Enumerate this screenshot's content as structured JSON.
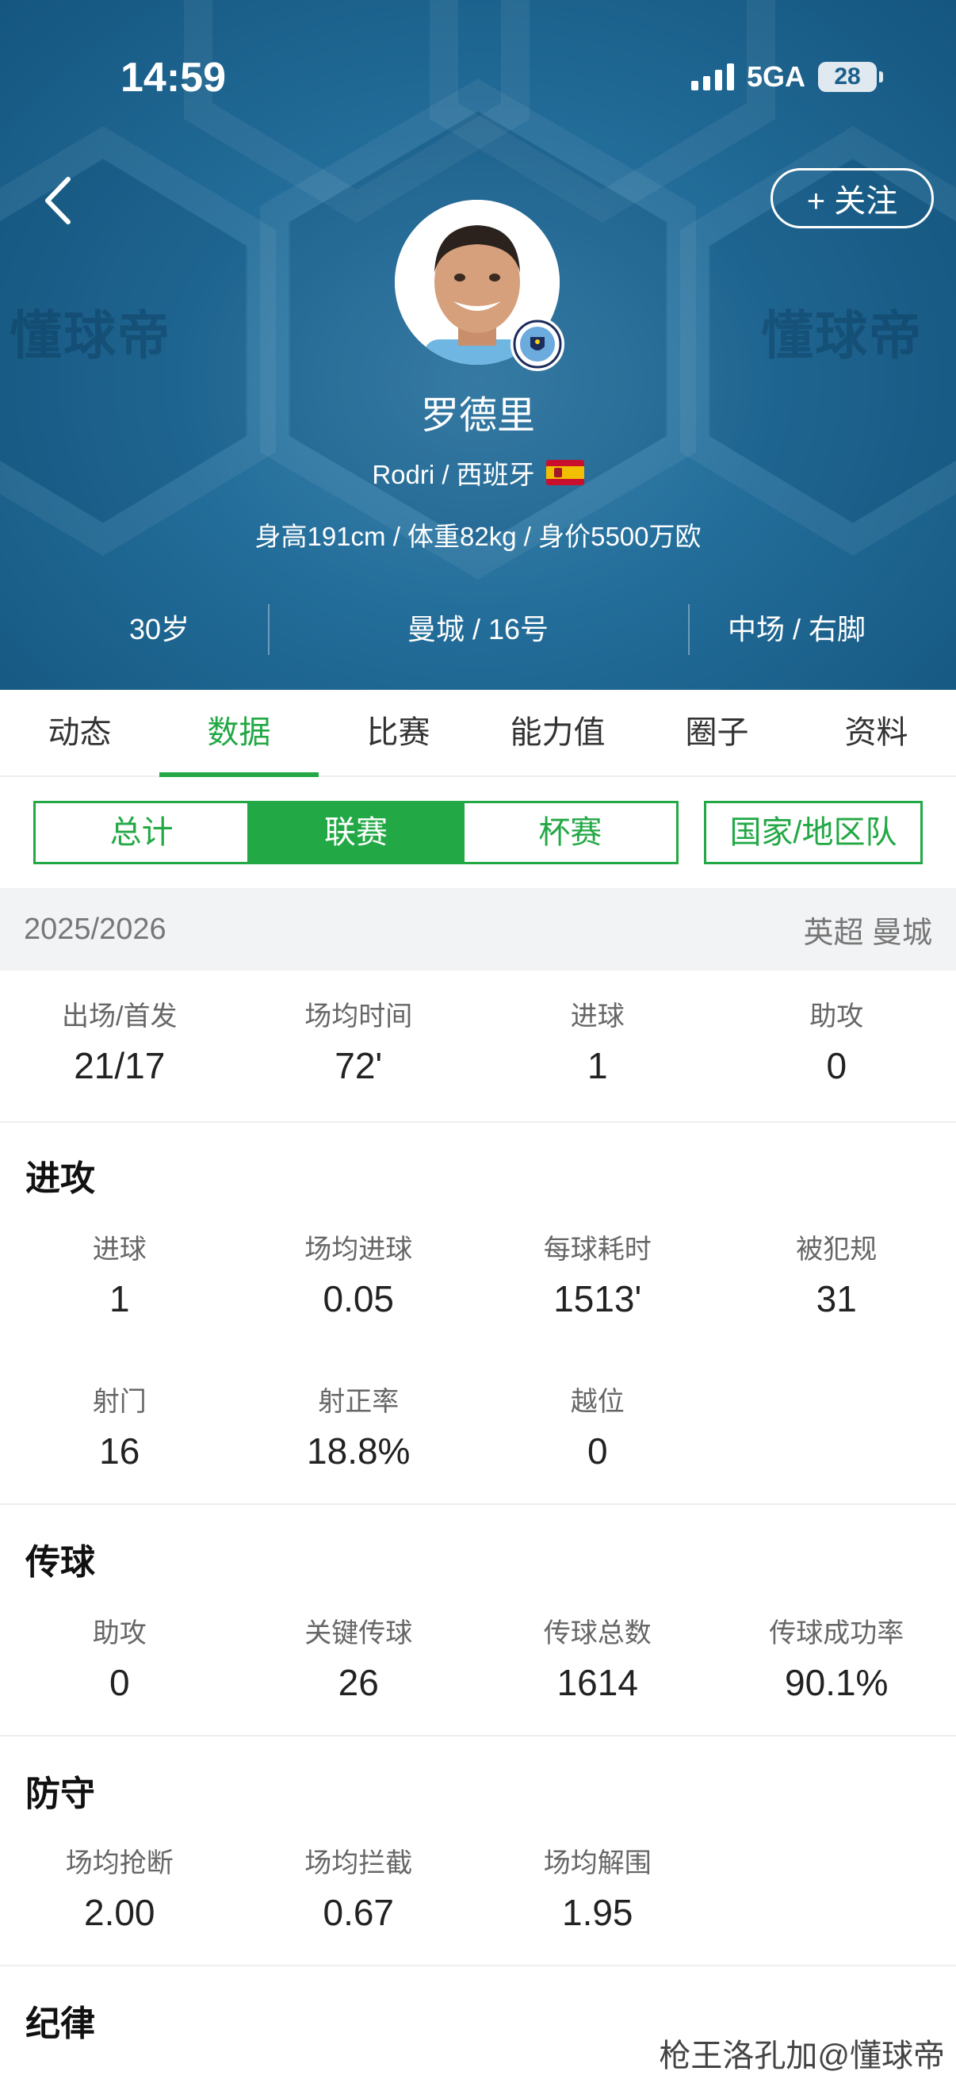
{
  "status_bar": {
    "time": "14:59",
    "network": "5GA",
    "battery": "28"
  },
  "header": {
    "watermark": "懂球帝",
    "follow_label": "+ 关注",
    "player_name": "罗德里",
    "subtitle": "Rodri / 西班牙",
    "body_info": "身高191cm / 体重82kg / 身价5500万欧",
    "info_cells": [
      "30岁",
      "曼城 / 16号",
      "中场 / 右脚"
    ]
  },
  "tabs": [
    "动态",
    "数据",
    "比赛",
    "能力值",
    "圈子",
    "资料"
  ],
  "active_tab": 1,
  "segment": {
    "options": [
      "总计",
      "联赛",
      "杯赛"
    ],
    "active": 1,
    "national_label": "国家/地区队"
  },
  "season": {
    "year": "2025/2026",
    "competition": "英超 曼城"
  },
  "summary": [
    {
      "label": "出场/首发",
      "value": "21/17"
    },
    {
      "label": "场均时间",
      "value": "72'"
    },
    {
      "label": "进球",
      "value": "1"
    },
    {
      "label": "助攻",
      "value": "0"
    }
  ],
  "sections": {
    "attack": {
      "title": "进攻",
      "row1": [
        {
          "label": "进球",
          "value": "1"
        },
        {
          "label": "场均进球",
          "value": "0.05"
        },
        {
          "label": "每球耗时",
          "value": "1513'"
        },
        {
          "label": "被犯规",
          "value": "31"
        }
      ],
      "row2": [
        {
          "label": "射门",
          "value": "16"
        },
        {
          "label": "射正率",
          "value": "18.8%"
        },
        {
          "label": "越位",
          "value": "0"
        }
      ]
    },
    "passing": {
      "title": "传球",
      "row1": [
        {
          "label": "助攻",
          "value": "0"
        },
        {
          "label": "关键传球",
          "value": "26"
        },
        {
          "label": "传球总数",
          "value": "1614"
        },
        {
          "label": "传球成功率",
          "value": "90.1%"
        }
      ]
    },
    "defense": {
      "title": "防守",
      "row1": [
        {
          "label": "场均抢断",
          "value": "2.00"
        },
        {
          "label": "场均拦截",
          "value": "0.67"
        },
        {
          "label": "场均解围",
          "value": "1.95"
        }
      ]
    },
    "discipline": {
      "title": "纪律"
    }
  },
  "credit": "枪王洛孔加@懂球帝",
  "colors": {
    "accent": "#22a845",
    "header_bg": "#236d9a"
  }
}
